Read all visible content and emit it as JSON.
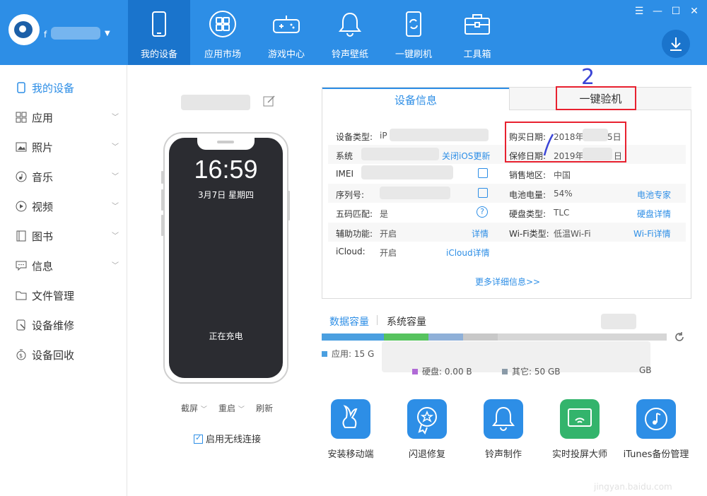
{
  "header": {
    "user_initial": "f",
    "nav": [
      {
        "label": "我的设备",
        "icon": "phone-icon"
      },
      {
        "label": "应用市场",
        "icon": "app-store-icon"
      },
      {
        "label": "游戏中心",
        "icon": "gamepad-icon"
      },
      {
        "label": "铃声壁纸",
        "icon": "bell-icon"
      },
      {
        "label": "一键刷机",
        "icon": "flash-icon"
      },
      {
        "label": "工具箱",
        "icon": "toolbox-icon"
      }
    ],
    "window_controls": [
      "☰",
      "—",
      "☐",
      "✕"
    ]
  },
  "sidebar": {
    "items": [
      {
        "label": "我的设备",
        "icon": "phone-icon"
      },
      {
        "label": "应用",
        "icon": "grid-icon"
      },
      {
        "label": "照片",
        "icon": "image-icon"
      },
      {
        "label": "音乐",
        "icon": "music-icon"
      },
      {
        "label": "视频",
        "icon": "video-icon"
      },
      {
        "label": "图书",
        "icon": "book-icon"
      },
      {
        "label": "信息",
        "icon": "message-icon"
      },
      {
        "label": "文件管理",
        "icon": "folder-icon"
      },
      {
        "label": "设备维修",
        "icon": "repair-icon"
      },
      {
        "label": "设备回收",
        "icon": "recycle-icon"
      }
    ]
  },
  "device": {
    "time": "16:59",
    "date": "3月7日 星期四",
    "charging": "正在充电",
    "actions": [
      "截屏",
      "重启",
      "刷新"
    ],
    "wireless_label": "启用无线连接"
  },
  "info": {
    "tab_active": "设备信息",
    "tab_inactive": "一键验机",
    "annotation_mark": "2",
    "left_rows": [
      {
        "label": "设备类型:",
        "value": "iP",
        "link": ""
      },
      {
        "label": "系统",
        "value": "",
        "link": "关闭iOS更新"
      },
      {
        "label": "IMEI",
        "value": "",
        "link": ""
      },
      {
        "label": "序列号:",
        "value": "",
        "link": ""
      },
      {
        "label": "五码匹配:",
        "value": "是",
        "link": ""
      },
      {
        "label": "辅助功能:",
        "value": "开启",
        "link": "详情"
      },
      {
        "label": "iCloud:",
        "value": "开启",
        "link": "iCloud详情"
      }
    ],
    "right_rows": [
      {
        "label": "购买日期:",
        "value": "2018年",
        "suffix": "5日",
        "link": ""
      },
      {
        "label": "保修日期:",
        "value": "2019年",
        "suffix": "日",
        "link": ""
      },
      {
        "label": "销售地区:",
        "value": "中国",
        "suffix": "",
        "link": ""
      },
      {
        "label": "电池电量:",
        "value": "54%",
        "suffix": "",
        "link": "电池专家"
      },
      {
        "label": "硬盘类型:",
        "value": "TLC",
        "suffix": "",
        "link": "硬盘详情"
      },
      {
        "label": "Wi-Fi类型:",
        "value": "低温Wi-Fi",
        "suffix": "",
        "link": "Wi-Fi详情"
      }
    ],
    "more": "更多详细信息>>"
  },
  "capacity": {
    "tab_data": "数据容量",
    "tab_system": "系统容量",
    "legend": [
      {
        "label": "应用: 15 G",
        "color": "#4a9fe0"
      },
      {
        "label": "硬盘: 0.00 B",
        "color": "#b06ad6"
      },
      {
        "label": "其它: 50 GB",
        "color": "#8a9aa8"
      },
      {
        "label": "GB",
        "color": "#f0b080"
      }
    ],
    "segments": [
      {
        "fraction": 0.18,
        "color": "#4a9fe0"
      },
      {
        "fraction": 0.13,
        "color": "#57c35f"
      },
      {
        "fraction": 0.1,
        "color": "#8fb0d8"
      },
      {
        "fraction": 0.1,
        "color": "#c8c8c8"
      }
    ]
  },
  "tools": [
    {
      "label": "安装移动端",
      "icon": "rabbit-icon"
    },
    {
      "label": "闪退修复",
      "icon": "badge-icon"
    },
    {
      "label": "铃声制作",
      "icon": "bell-icon"
    },
    {
      "label": "实时投屏大师",
      "icon": "screencast-icon"
    },
    {
      "label": "iTunes备份管理",
      "icon": "music-backup-icon"
    }
  ],
  "watermark": "jingyan.baidu.com"
}
